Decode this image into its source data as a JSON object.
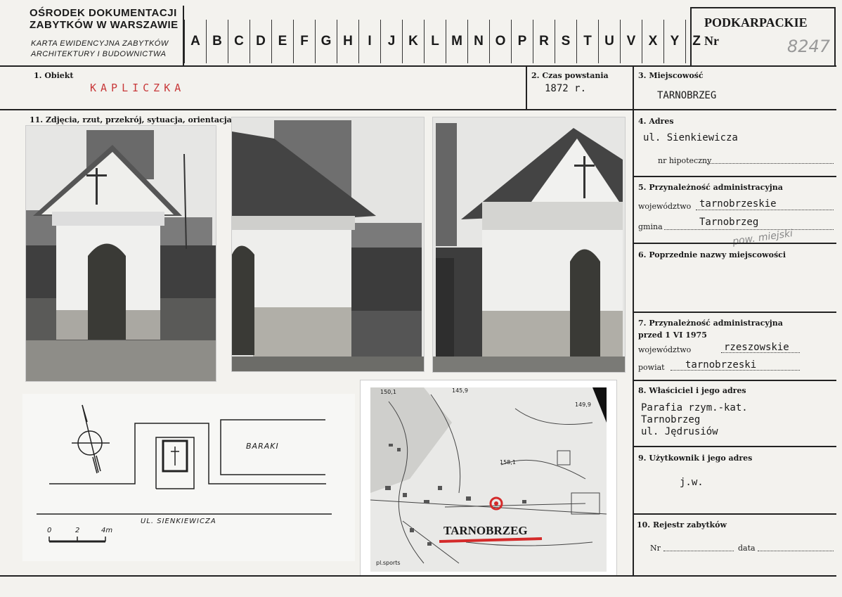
{
  "header": {
    "institution_line1": "OŚRODEK DOKUMENTACJI",
    "institution_line2": "ZABYTKÓW W WARSZAWIE",
    "card_line1": "KARTA EWIDENCYJNA ZABYTKÓW",
    "card_line2": "ARCHITEKTURY I BUDOWNICTWA",
    "letters": [
      "A",
      "B",
      "C",
      "D",
      "E",
      "F",
      "G",
      "H",
      "I",
      "J",
      "K",
      "L",
      "M",
      "N",
      "O",
      "P",
      "R",
      "S",
      "T",
      "U",
      "V",
      "X",
      "Y",
      "Z"
    ],
    "region": "PODKARPACKIE",
    "nr_label": "Nr",
    "nr_value": "8247"
  },
  "fields": {
    "obiekt_label": "1. Obiekt",
    "obiekt_value": "KAPLICZKA",
    "czas_label": "2. Czas powstania",
    "czas_value": "1872 r.",
    "miejscowosc_label": "3. Miejscowość",
    "miejscowosc_value": "TARNOBRZEG",
    "zdjecia_label": "11. Zdjęcia, rzut, przekrój, sytuacja, orientacja",
    "adres_label": "4. Adres",
    "adres_value": "ul. Sienkiewicza",
    "hipoteczny_label": "nr hipoteczny",
    "przynaleznosc_label": "5. Przynależność administracyjna",
    "wojewodztwo_label": "województwo",
    "wojewodztwo_value": "tarnobrzeskie",
    "gmina_label": "gmina",
    "gmina_value": "Tarnobrzeg",
    "gmina_note": "pow. miejski",
    "poprzednie_label": "6. Poprzednie nazwy miejscowości",
    "przynaleznosc7_label": "7. Przynależność administracyjna",
    "przed_label": "przed 1 VI 1975",
    "woj7_label": "województwo",
    "woj7_value": "rzeszowskie",
    "powiat_label": "powiat",
    "powiat_value": "tarnobrzeski",
    "wlasciciel_label": "8. Właściciel i jego adres",
    "wlasciciel_line1": "Parafia rzym.-kat.",
    "wlasciciel_line2": "Tarnobrzeg",
    "wlasciciel_line3": "ul. Jędrusiów",
    "uzytkownik_label": "9. Użytkownik i jego adres",
    "uzytkownik_value": "j.w.",
    "rejestr_label": "10. Rejestr zabytków",
    "nr_label": "Nr",
    "data_label": "data"
  },
  "plan": {
    "baraki": "BARAKI",
    "street": "UL. SIENKIEWICZA",
    "scale_0": "0",
    "scale_2": "2",
    "scale_4": "4m"
  },
  "map": {
    "town": "TARNOBRZEG",
    "elev1": "158,1",
    "elev2": "145,9",
    "elev3": "149,9",
    "elev4": "150,1",
    "sports": "pl.sports"
  }
}
